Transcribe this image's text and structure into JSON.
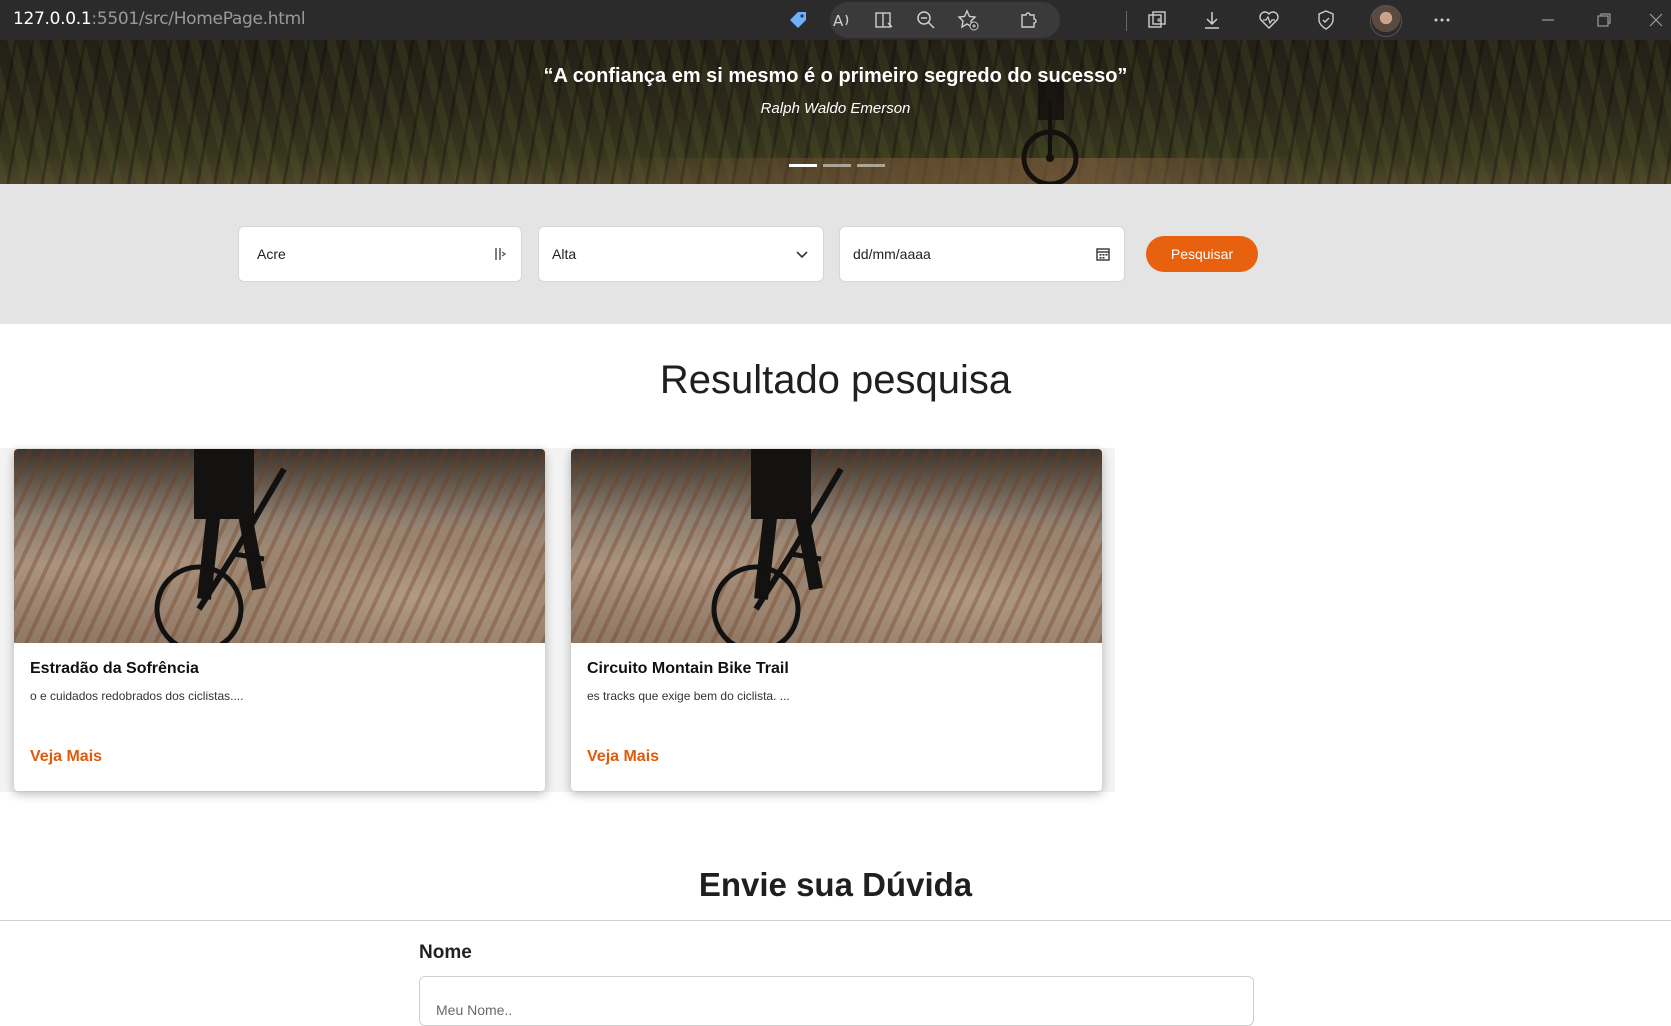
{
  "browser": {
    "url_host": "127.0.0.1",
    "url_rest": ":5501/src/HomePage.html"
  },
  "hero": {
    "quote": "“A confiança em si mesmo é o primeiro segredo do sucesso”",
    "author": "Ralph Waldo Emerson",
    "slides": 3,
    "active_slide": 1
  },
  "search": {
    "state_value": "Acre",
    "difficulty_value": "Alta",
    "date_placeholder": "dd/mm/aaaa",
    "button_label": "Pesquisar"
  },
  "results": {
    "title": "Resultado pesquisa",
    "cards": [
      {
        "title": "Estradão da Sofrência",
        "desc": "o e cuidados redobrados dos ciclistas....",
        "link": "Veja Mais"
      },
      {
        "title": "Circuito Montain Bike Trail",
        "desc": "es tracks que exige bem do ciclista. ...",
        "link": "Veja Mais"
      }
    ]
  },
  "question": {
    "title": "Envie sua Dúvida",
    "name_label": "Nome",
    "name_placeholder": "Meu Nome.."
  },
  "colors": {
    "accent": "#e8610e",
    "link": "#e05a0c",
    "search_band": "#e4e4e4"
  },
  "icons": [
    "tag-icon",
    "read-aloud-icon",
    "reader-icon",
    "zoom-out-icon",
    "favorite-add-icon",
    "extensions-icon",
    "collections-icon",
    "downloads-icon",
    "health-icon",
    "shield-icon",
    "more-icon",
    "minimize-icon",
    "restore-icon",
    "close-icon",
    "calendar-icon",
    "chevron-down-icon",
    "datalist-icon"
  ]
}
